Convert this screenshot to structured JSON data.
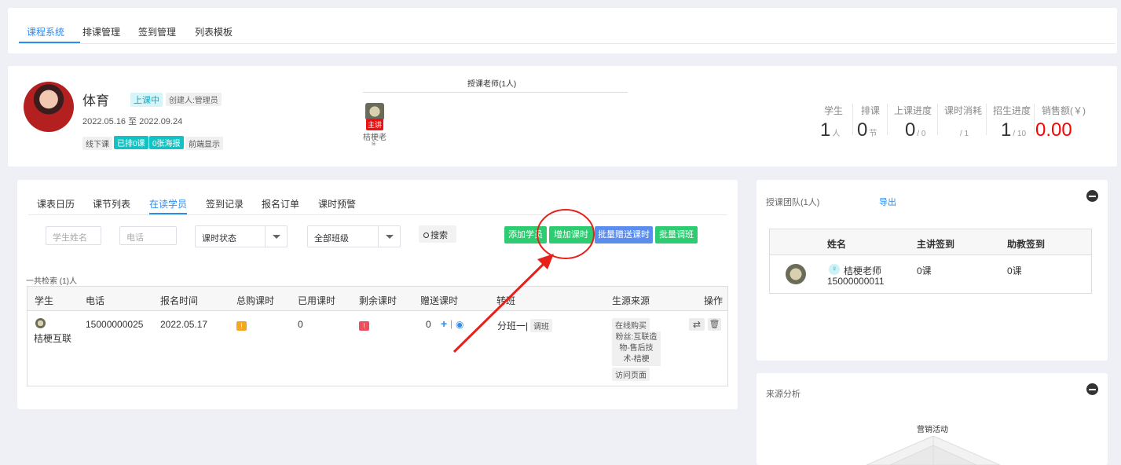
{
  "top_tabs": [
    "课程系统",
    "排课管理",
    "签到管理",
    "列表模板"
  ],
  "course": {
    "name": "体育",
    "status": "上课中",
    "creator": "创建人:管理员",
    "dates": "2022.05.16 至 2022.09.24",
    "tags": [
      "线下课",
      "已排0课",
      "0张海报",
      "前端显示"
    ],
    "teachers_title": "授课老师(1人)",
    "teacher_badge": "主讲",
    "teacher_name": "桔梗老",
    "teacher_name2": "师"
  },
  "stats": [
    {
      "label": "学生",
      "value": "1",
      "unit": "人"
    },
    {
      "label": "排课",
      "value": "0",
      "unit": "节"
    },
    {
      "label": "上课进度",
      "value": "0",
      "unit": "/ 0"
    },
    {
      "label": "课时消耗",
      "value": "",
      "unit": "/ 1"
    },
    {
      "label": "招生进度",
      "value": "1",
      "unit": "/ 10"
    },
    {
      "label": "销售额(￥)",
      "value": "0.00",
      "unit": ""
    }
  ],
  "sub_tabs": [
    "课表日历",
    "课节列表",
    "在读学员",
    "签到记录",
    "报名订单",
    "课时预警"
  ],
  "filters": {
    "name_placeholder": "学生姓名",
    "phone_placeholder": "电话",
    "status_select": "课时状态",
    "class_select": "全部班级",
    "search": "搜索"
  },
  "actions": [
    "添加学员",
    "增加课时",
    "批量赠送课时",
    "批量调班"
  ],
  "total": "一共检索 (1)人",
  "table": {
    "headers": [
      "学生",
      "电话",
      "报名时间",
      "总购课时",
      "已用课时",
      "剩余课时",
      "赠送课时",
      "转班",
      "生源来源",
      "操作"
    ],
    "row": {
      "student": "桔梗互联",
      "phone": "15000000025",
      "date": "2022.05.17",
      "total_badge": "!",
      "used": "0",
      "remain_badge": "!",
      "gift": "0",
      "class_name": "分班一|",
      "class_tag": "调班",
      "source1": "在线购买",
      "source2": "粉丝:互联造物-售后技术-桔梗",
      "source3": "访问页面"
    }
  },
  "team": {
    "title": "授课团队(1人)",
    "export": "导出",
    "headers": [
      "姓名",
      "主讲签到",
      "助教签到"
    ],
    "member_name": "桔梗老师",
    "member_phone": "15000000011",
    "main_sign": "0课",
    "assist_sign": "0课"
  },
  "source_analysis": {
    "title": "来源分析",
    "radar_label": "营销活动"
  },
  "colors": {
    "accent": "#2d8cf0",
    "green": "#2ecc71",
    "blue": "#5b8def",
    "red": "#ff0000",
    "cyan": "#19be6b"
  }
}
